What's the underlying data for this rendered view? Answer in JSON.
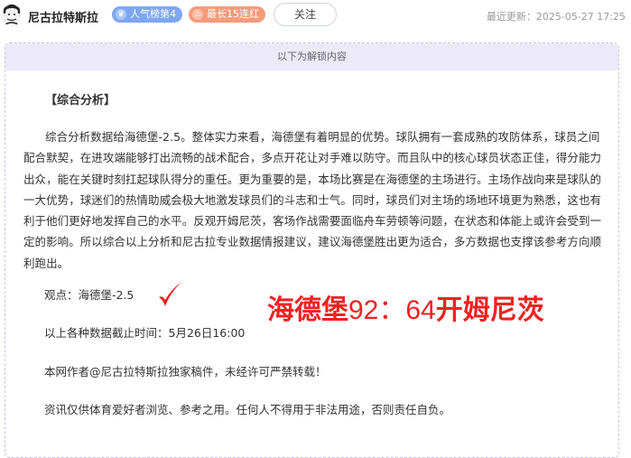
{
  "header": {
    "author": "尼古拉特斯拉",
    "badge_rank": "人气榜第4",
    "badge_streak": "最长15连红",
    "follow_label": "关注",
    "updated": "最近更新：2025-05-27 17:25"
  },
  "panel": {
    "unlock_notice": "以下为解锁内容",
    "section_title": "【综合分析】",
    "paragraph": "综合分析数据给海德堡-2.5。整体实力来看，海德堡有着明显的优势。球队拥有一套成熟的攻防体系，球员之间配合默契，在进攻端能够打出流畅的战术配合，多点开花让对手难以防守。而且队中的核心球员状态正佳，得分能力出众，能在关键时刻扛起球队得分的重任。更为重要的是，本场比赛是在海德堡的主场进行。主场作战向来是球队的一大优势，球迷们的热情助威会极大地激发球员们的斗志和士气。同时，球员们对主场的场地环境更为熟悉，这也有利于他们更好地发挥自己的水平。反观开姆尼茨，客场作战需要面临舟车劳顿等问题，在状态和体能上或许会受到一定的影响。所以综合以上分析和尼古拉专业数据情报建议，建议海德堡胜出更为适合，多方数据也支撑该参考方向顺利跑出。",
    "viewpoint": "观点：海德堡-2.5",
    "score_home": "海德堡",
    "score_value": "92：64",
    "score_away": "开姆尼茨",
    "data_cutoff": "以上各种数据截止时间：5月26日16:00",
    "copyright": "本网作者@尼古拉特斯拉独家稿件，未经许可严禁转载！",
    "disclaimer": "资讯仅供体育爱好者浏览、参考之用。任何人不得用于非法用途，否则责任自负。"
  },
  "icons": {
    "avatar": "avatar-portrait",
    "rank_badge_icon": "crown-icon",
    "streak_badge_icon": "fire-icon",
    "checkmark": "red-checkmark-icon"
  },
  "colors": {
    "rank_badge": "#7ea6f3",
    "streak_badge": "#f79b7a",
    "score_red": "#ee2222",
    "unlock_bar": "#eceaf8"
  }
}
